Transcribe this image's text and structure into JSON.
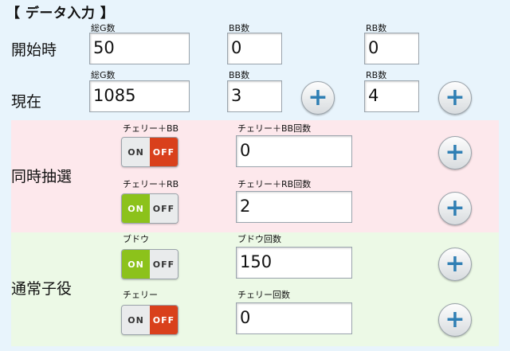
{
  "title": "【 データ入力 】",
  "start": {
    "label": "開始時",
    "total_label": "総G数",
    "total_value": "50",
    "bb_label": "BB数",
    "bb_value": "0",
    "rb_label": "RB数",
    "rb_value": "0"
  },
  "current": {
    "label": "現在",
    "total_label": "総G数",
    "total_value": "1085",
    "bb_label": "BB数",
    "bb_value": "3",
    "rb_label": "RB数",
    "rb_value": "4",
    "plus": "+"
  },
  "simultaneous": {
    "label": "同時抽選",
    "cherry_bb": {
      "toggle_label": "チェリー＋BB",
      "on": "ON",
      "off": "OFF",
      "state": "off",
      "count_label": "チェリー＋BB回数",
      "count_value": "0",
      "plus": "+"
    },
    "cherry_rb": {
      "toggle_label": "チェリー＋RB",
      "on": "ON",
      "off": "OFF",
      "state": "on",
      "count_label": "チェリー＋RB回数",
      "count_value": "2",
      "plus": "+"
    }
  },
  "normal": {
    "label": "通常子役",
    "budou": {
      "toggle_label": "ブドウ",
      "on": "ON",
      "off": "OFF",
      "state": "on",
      "count_label": "ブドウ回数",
      "count_value": "150",
      "plus": "+"
    },
    "cherry": {
      "toggle_label": "チェリー",
      "on": "ON",
      "off": "OFF",
      "state": "off",
      "count_label": "チェリー回数",
      "count_value": "0",
      "plus": "+"
    }
  },
  "colors": {
    "background": "#e8f4fc",
    "pink_panel": "#fde8ec",
    "green_panel": "#ecf9e6",
    "toggle_on": "#8cc21b",
    "toggle_off": "#d9401c",
    "plus_icon": "#2f7fb4"
  }
}
